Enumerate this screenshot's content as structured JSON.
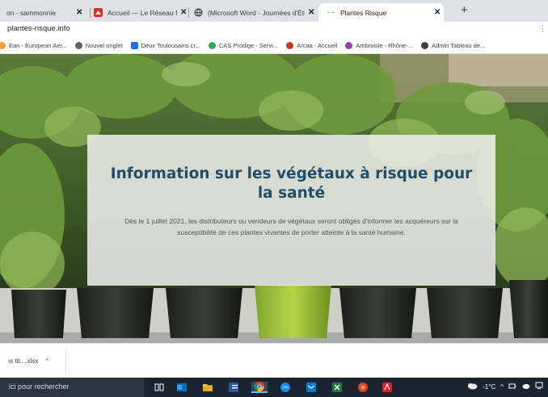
{
  "browser": {
    "tabs": [
      {
        "title": "on - sammonnie",
        "active": false
      },
      {
        "title": "Accueil — Le Réseau National de",
        "active": false
      },
      {
        "title": "(Microsoft Word - Journées d'Étu",
        "active": false
      },
      {
        "title": "Plantes Risque",
        "active": true
      }
    ],
    "tab_close_glyph": "✕",
    "new_tab_glyph": "+",
    "url": "plantes-risque.info",
    "bookmarks": [
      {
        "label": "Ean - European Aer...",
        "color": "#e6a23c"
      },
      {
        "label": "Nouvel onglet",
        "color": "#5f6368"
      },
      {
        "label": "Deux Toulousains cr...",
        "color": "#1a73e8"
      },
      {
        "label": "CAS Prodige - Servi...",
        "color": "#34a853"
      },
      {
        "label": "Arcaa - Accueil",
        "color": "#c0392b"
      },
      {
        "label": "Ambroisie - Rhône-...",
        "color": "#8e44ad"
      },
      {
        "label": "Admin Tableau de...",
        "color": "#3c4043"
      }
    ]
  },
  "page": {
    "heading": "Information sur les végétaux à risque pour la santé",
    "body": "Dès le 1 juillet 2021, les distributeurs ou vendeurs de végétaux seront obligés d'informer les acquéreurs sur la susceptibilité de ces plantes vivantes de porter atteinte à la santé humaine.",
    "heading_color": "#1f4e6b"
  },
  "downloads": {
    "item_label": "ıs tit....xlsx",
    "chevron": "^"
  },
  "taskbar": {
    "search_text": "ici pour rechercher",
    "icons": [
      "task-view-icon",
      "outlook-icon",
      "file-explorer-icon",
      "word-icon",
      "chrome-icon",
      "edge-icon",
      "mail-icon",
      "excel-icon",
      "powerpoint-icon",
      "acrobat-icon"
    ],
    "temperature": "-1°C",
    "tray_chevron": "^"
  }
}
